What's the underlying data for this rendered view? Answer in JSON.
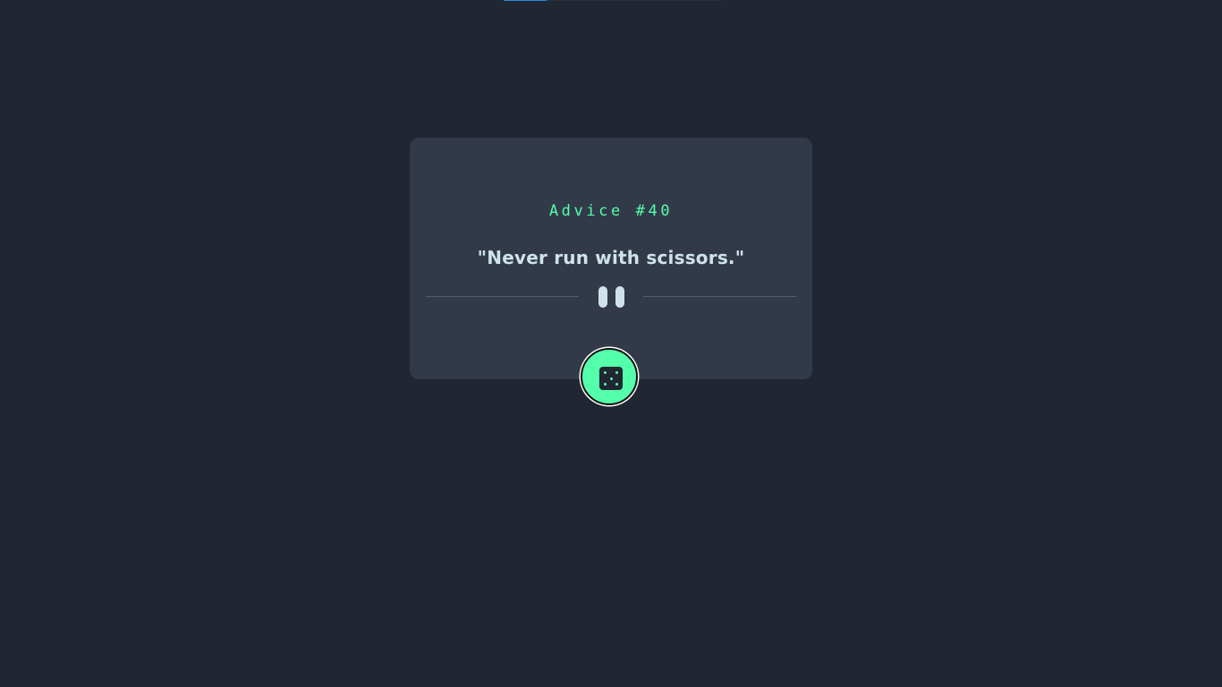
{
  "top_progress": {
    "value": 0.2
  },
  "card": {
    "advice_number_label": "Advice #40",
    "advice_text": "\"Never run with scissors.\"",
    "divider_icon": "pause-icon"
  },
  "dice_button": {
    "icon": "dice-icon"
  },
  "colors": {
    "background": "#202632",
    "card": "#323a49",
    "accent": "#53ffaa",
    "text": "#cee3e9",
    "divider": "#4f5d74"
  }
}
